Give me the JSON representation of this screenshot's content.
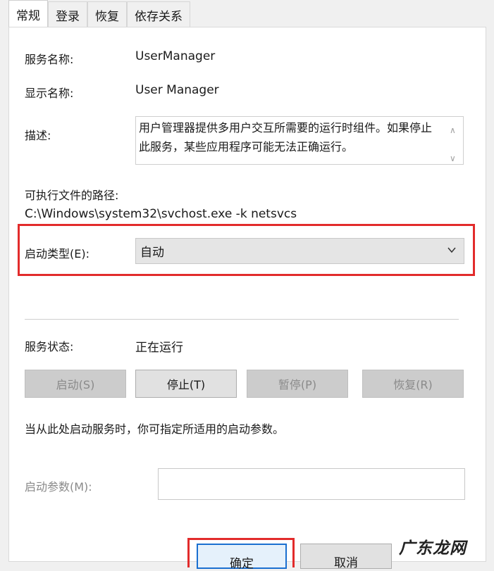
{
  "tabs": [
    "常规",
    "登录",
    "恢复",
    "依存关系"
  ],
  "service_name": {
    "label": "服务名称:",
    "value": "UserManager"
  },
  "display_name": {
    "label": "显示名称:",
    "value": "User Manager"
  },
  "description": {
    "label": "描述:",
    "value": "用户管理器提供多用户交互所需要的运行时组件。如果停止此服务，某些应用程序可能无法正确运行。"
  },
  "exec_path": {
    "label": "可执行文件的路径:",
    "value": "C:\\Windows\\system32\\svchost.exe -k netsvcs"
  },
  "startup_type": {
    "label": "启动类型(E):",
    "value": "自动"
  },
  "service_status": {
    "label": "服务状态:",
    "value": "正在运行"
  },
  "buttons": {
    "start": "启动(S)",
    "stop": "停止(T)",
    "pause": "暂停(P)",
    "resume": "恢复(R)"
  },
  "hint": "当从此处启动服务时，你可指定所适用的启动参数。",
  "start_params": {
    "label": "启动参数(M):",
    "value": ""
  },
  "footer": {
    "ok": "确定",
    "cancel": "取消"
  },
  "watermark": "广东龙网",
  "highlight_color": "#e22b2b"
}
